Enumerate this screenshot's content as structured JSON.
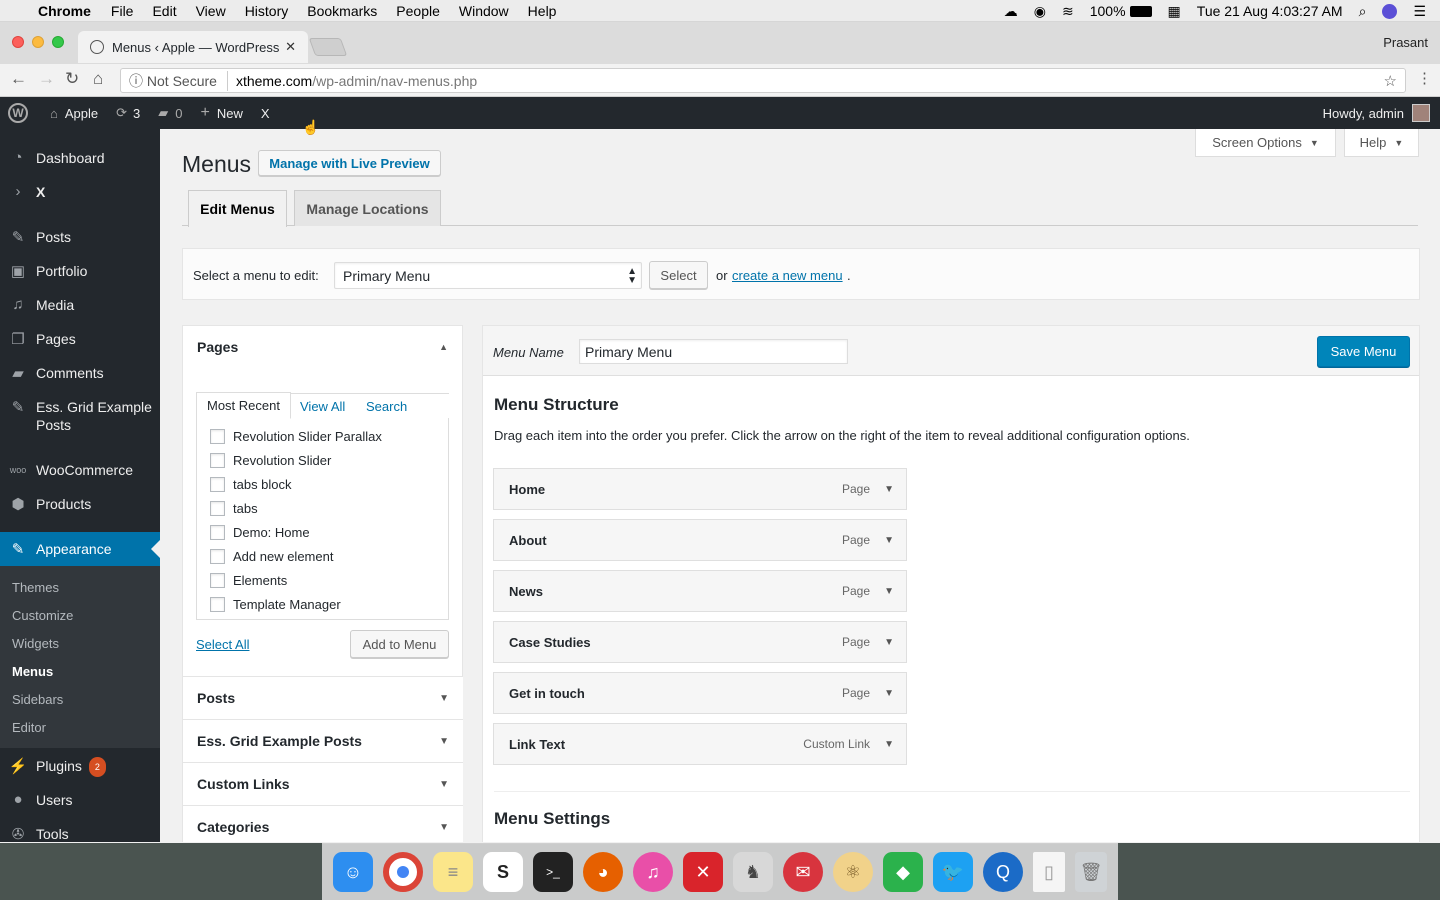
{
  "macmenu": {
    "app": "Chrome",
    "items": [
      "File",
      "Edit",
      "View",
      "History",
      "Bookmarks",
      "People",
      "Window",
      "Help"
    ],
    "battery": "100%",
    "clock": "Tue 21 Aug  4:03:27 AM"
  },
  "chrome": {
    "tab_title": "Menus ‹ Apple — WordPress",
    "profile": "Prasant",
    "not_secure": "Not Secure",
    "url_domain": "xtheme.com",
    "url_path": "/wp-admin/nav-menus.php"
  },
  "adminbar": {
    "site": "Apple",
    "updates": "3",
    "comments": "0",
    "new": "New",
    "x": "X",
    "howdy": "Howdy, admin"
  },
  "sidebar": {
    "items": [
      {
        "label": "Dashboard",
        "icon": "dashboard-icon"
      },
      {
        "label": "X",
        "icon": "chevron-right-icon"
      },
      {
        "label": "Posts",
        "icon": "pin-icon"
      },
      {
        "label": "Portfolio",
        "icon": "portfolio-icon"
      },
      {
        "label": "Media",
        "icon": "media-icon"
      },
      {
        "label": "Pages",
        "icon": "pages-icon"
      },
      {
        "label": "Comments",
        "icon": "comments-icon"
      },
      {
        "label": "Ess. Grid Example Posts",
        "icon": "pin-icon"
      },
      {
        "label": "WooCommerce",
        "icon": "woo-icon"
      },
      {
        "label": "Products",
        "icon": "products-icon"
      },
      {
        "label": "Appearance",
        "icon": "brush-icon"
      },
      {
        "label": "Plugins",
        "icon": "plugin-icon",
        "badge": "2"
      },
      {
        "label": "Users",
        "icon": "users-icon"
      },
      {
        "label": "Tools",
        "icon": "tools-icon"
      }
    ],
    "submenu": [
      "Themes",
      "Customize",
      "Widgets",
      "Menus",
      "Sidebars",
      "Editor"
    ]
  },
  "page": {
    "title": "Menus",
    "live_preview": "Manage with Live Preview",
    "screen_options": "Screen Options",
    "help": "Help",
    "tabs": [
      "Edit Menus",
      "Manage Locations"
    ],
    "select_label": "Select a menu to edit:",
    "select_value": "Primary Menu",
    "select_btn": "Select",
    "or": "or",
    "create_link": "create a new menu",
    "period": "."
  },
  "left": {
    "pages_title": "Pages",
    "tabs": [
      "Most Recent",
      "View All",
      "Search"
    ],
    "pages": [
      "Revolution Slider Parallax",
      "Revolution Slider",
      "tabs block",
      "tabs",
      "Demo: Home",
      "Add new element",
      "Elements",
      "Template Manager"
    ],
    "select_all": "Select All",
    "add_to_menu": "Add to Menu",
    "sections": [
      "Posts",
      "Ess. Grid Example Posts",
      "Custom Links",
      "Categories"
    ]
  },
  "right": {
    "menu_name_label": "Menu Name",
    "menu_name_value": "Primary Menu",
    "save": "Save Menu",
    "structure_title": "Menu Structure",
    "structure_desc": "Drag each item into the order you prefer. Click the arrow on the right of the item to reveal additional configuration options.",
    "items": [
      {
        "label": "Home",
        "type": "Page"
      },
      {
        "label": "About",
        "type": "Page"
      },
      {
        "label": "News",
        "type": "Page"
      },
      {
        "label": "Case Studies",
        "type": "Page"
      },
      {
        "label": "Get in touch",
        "type": "Page"
      },
      {
        "label": "Link Text",
        "type": "Custom Link"
      }
    ],
    "settings_title": "Menu Settings"
  },
  "dock": [
    "finder-icon",
    "chrome-icon",
    "notes-icon",
    "sketch-icon",
    "terminal-icon",
    "firefox-icon",
    "itunes-icon",
    "crossover-icon",
    "sequel-pro-icon",
    "airmail-icon",
    "atom-icon",
    "feedly-icon",
    "twitter-icon",
    "quicktime-icon",
    "file-icon",
    "trash-icon"
  ],
  "colors": {
    "wp_dark": "#23282d",
    "wp_blue": "#0073aa",
    "primary_btn": "#0085ba"
  }
}
